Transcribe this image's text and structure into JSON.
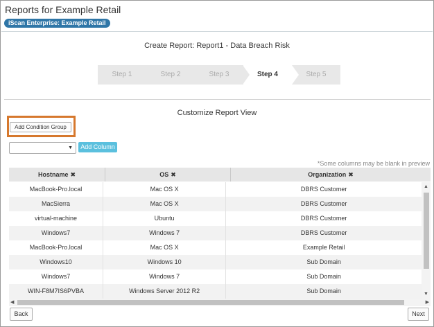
{
  "app": {
    "title": "Reports for Example Retail",
    "badge": "iScan Enterprise: Example Retail"
  },
  "report": {
    "heading": "Create Report: Report1 - Data Breach Risk"
  },
  "wizard": {
    "steps": [
      "Step 1",
      "Step 2",
      "Step 3",
      "Step 4",
      "Step 5"
    ],
    "active_step": "Step 4"
  },
  "customize": {
    "title": "Customize Report View",
    "add_condition_label": "Add Condition Group",
    "column_select_value": "",
    "add_column_label": "Add Column",
    "note": "*Some columns may be blank in preview"
  },
  "table": {
    "columns": [
      {
        "label": "Hostname",
        "remove_icon": "close-icon"
      },
      {
        "label": "OS",
        "remove_icon": "close-icon"
      },
      {
        "label": "Organization",
        "remove_icon": "close-icon"
      }
    ],
    "rows": [
      [
        "MacBook-Pro.local",
        "Mac OS X",
        "DBRS Customer"
      ],
      [
        "MacSierra",
        "Mac OS X",
        "DBRS Customer"
      ],
      [
        "virtual-machine",
        "Ubuntu",
        "DBRS Customer"
      ],
      [
        "Windows7",
        "Windows 7",
        "DBRS Customer"
      ],
      [
        "MacBook-Pro.local",
        "Mac OS X",
        "Example Retail"
      ],
      [
        "Windows10",
        "Windows 10",
        "Sub Domain"
      ],
      [
        "Windows7",
        "Windows 7",
        "Sub Domain"
      ],
      [
        "WIN-F8M7IS6PVBA",
        "Windows Server 2012 R2",
        "Sub Domain"
      ]
    ]
  },
  "footer": {
    "back_label": "Back",
    "next_label": "Next"
  },
  "colors": {
    "badge": "#2f76a7",
    "add_column": "#5bc0de",
    "highlight": "#d6782d"
  }
}
